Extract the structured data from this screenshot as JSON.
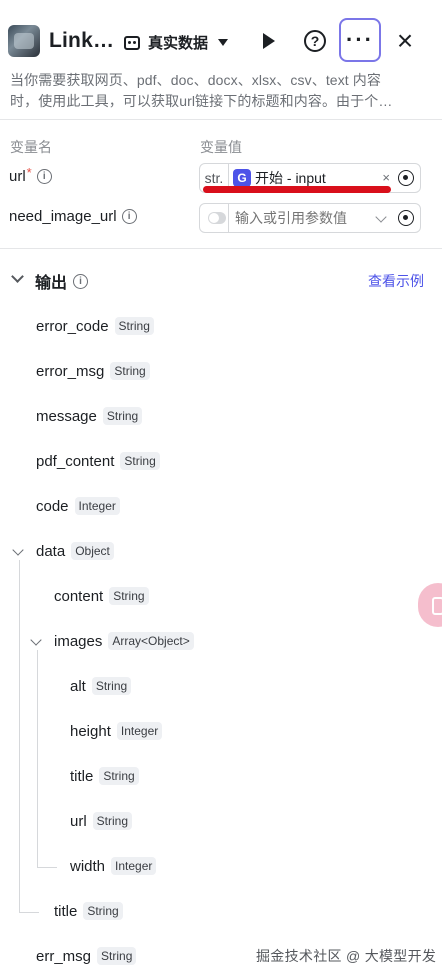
{
  "header": {
    "title": "Link…",
    "mode_label": "真实数据",
    "help_glyph": "?",
    "more_glyph": "···",
    "close_glyph": "×"
  },
  "description": {
    "line1": "当你需要获取网页、pdf、doc、docx、xlsx、csv、text 内容",
    "line2": "时，使用此工具，可以获取url链接下的标题和内容。由于个…"
  },
  "inputs": {
    "col_name": "变量名",
    "col_value": "变量值",
    "rows": [
      {
        "name": "url",
        "required_mark": "*",
        "type_prefix": "str.",
        "ref_label": "开始 - input",
        "clear": "×"
      },
      {
        "name": "need_image_url",
        "placeholder": "输入或引用参数值"
      }
    ]
  },
  "output": {
    "title": "输出",
    "example_link": "查看示例",
    "items": [
      {
        "name": "error_code",
        "type": "String"
      },
      {
        "name": "error_msg",
        "type": "String"
      },
      {
        "name": "message",
        "type": "String"
      },
      {
        "name": "pdf_content",
        "type": "String"
      },
      {
        "name": "code",
        "type": "Integer"
      },
      {
        "name": "data",
        "type": "Object"
      },
      {
        "name": "content",
        "type": "String"
      },
      {
        "name": "images",
        "type": "Array<Object>"
      },
      {
        "name": "alt",
        "type": "String"
      },
      {
        "name": "height",
        "type": "Integer"
      },
      {
        "name": "title",
        "type": "String"
      },
      {
        "name": "url",
        "type": "String"
      },
      {
        "name": "width",
        "type": "Integer"
      },
      {
        "name": "title",
        "type": "String"
      },
      {
        "name": "err_msg",
        "type": "String"
      }
    ]
  },
  "watermark": "掘金技术社区 @ 大模型开发",
  "colors": {
    "accent": "#4d53e8",
    "highlight_line": "#d90f1b",
    "required": "#e54d42"
  }
}
